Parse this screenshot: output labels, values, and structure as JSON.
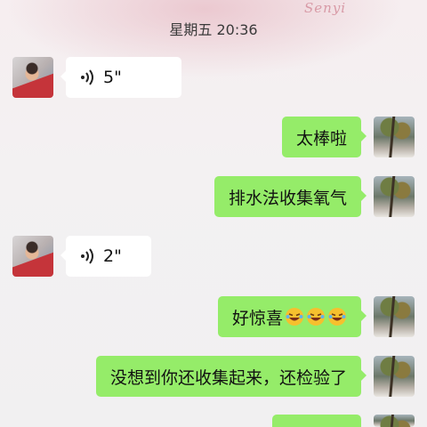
{
  "timestamp": "星期五 20:36",
  "signature": "Senyi",
  "messages": [
    {
      "side": "left",
      "type": "voice",
      "duration": "5\"",
      "avatar": "boy-avatar"
    },
    {
      "side": "right",
      "type": "text",
      "text": "太棒啦",
      "avatar": "tree-avatar"
    },
    {
      "side": "right",
      "type": "text",
      "text": "排水法收集氧气",
      "avatar": "tree-avatar"
    },
    {
      "side": "left",
      "type": "voice",
      "duration": "2\"",
      "avatar": "boy-avatar"
    },
    {
      "side": "right",
      "type": "text",
      "text": "好惊喜",
      "emoji": "laughing-face-emoji x3",
      "avatar": "tree-avatar"
    },
    {
      "side": "right",
      "type": "text",
      "text": "没想到你还收集起来，还检验了",
      "avatar": "tree-avatar"
    }
  ],
  "colors": {
    "outgoing_bubble": "#95ec69",
    "incoming_bubble": "#ffffff",
    "background": "#f3f0f1"
  }
}
